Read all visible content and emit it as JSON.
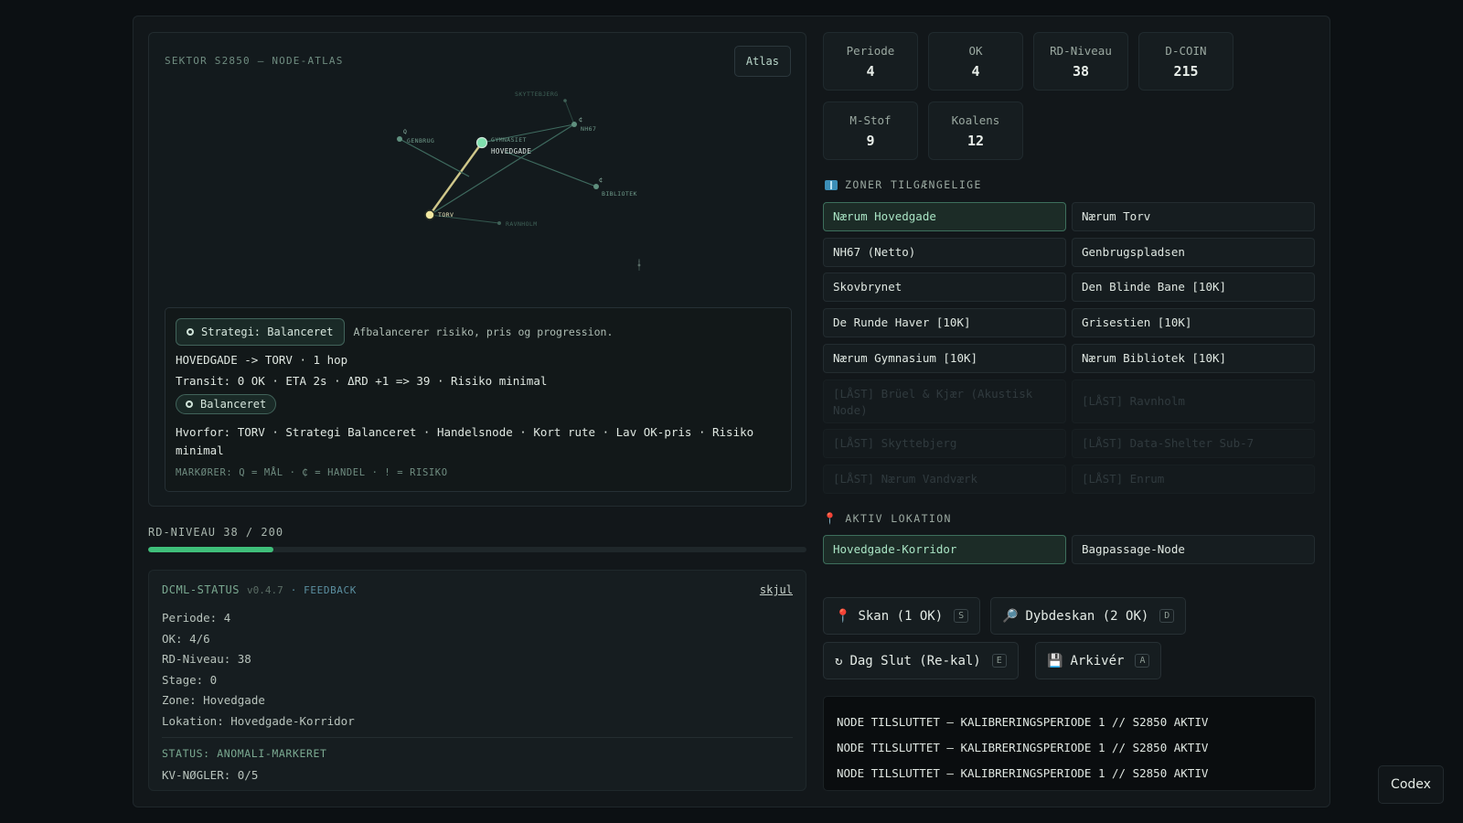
{
  "atlas": {
    "title": "SEKTOR S2850 — NODE-ATLAS",
    "button": "Atlas",
    "nodes": [
      {
        "id": "genbrug",
        "label": "GENBRUG",
        "marker": "Q"
      },
      {
        "id": "gymnasiet",
        "label": "GYMNASIET",
        "marker": ""
      },
      {
        "id": "hovedgade",
        "label": "HOVEDGADE",
        "marker": ""
      },
      {
        "id": "nh67",
        "label": "NH67",
        "marker": "₵"
      },
      {
        "id": "bibliotek",
        "label": "BIBLIOTEK",
        "marker": "₵"
      },
      {
        "id": "torv",
        "label": "TORV",
        "marker": ""
      },
      {
        "id": "ravnholm",
        "label": "RAVNHOLM",
        "marker": ""
      },
      {
        "id": "skyttebjerg",
        "label": "SKYTTEBJERG",
        "marker": ""
      }
    ],
    "dim_marker": "!"
  },
  "strategy": {
    "chip": "Strategi: Balanceret",
    "description": "Afbalancerer risiko, pris og progression.",
    "route": "HOVEDGADE -> TORV · 1 hop",
    "transit": "Transit: 0 OK · ETA 2s · ΔRD +1 => 39 · Risiko minimal",
    "pill": "Balanceret",
    "why": "Hvorfor: TORV · Strategi Balanceret · Handelsnode · Kort rute · Lav OK-pris · Risiko minimal",
    "markers": "MARKØRER: Q = MÅL · ₵ = HANDEL · ! = RISIKO"
  },
  "rd": {
    "label": "RD-NIVEAU 38 / 200",
    "current": 38,
    "max": 200,
    "color": "#3fbf7a"
  },
  "status": {
    "title": "DCML-STATUS",
    "version": "v0.4.7",
    "feedback": "· FEEDBACK",
    "hide": "skjul",
    "lines": [
      "Periode: 4",
      "OK: 4/6",
      "RD-Niveau: 38",
      "Stage: 0",
      "Zone: Hovedgade",
      "Lokation: Hovedgade-Korridor"
    ],
    "anomaly": "STATUS: ANOMALI-MARKERET",
    "kv": "KV-NØGLER: 0/5"
  },
  "stats": [
    {
      "label": "Periode",
      "value": "4"
    },
    {
      "label": "OK",
      "value": "4"
    },
    {
      "label": "RD-Niveau",
      "value": "38"
    },
    {
      "label": "D-COIN",
      "value": "215"
    },
    {
      "label": "M-Stof",
      "value": "9"
    },
    {
      "label": "Koalens",
      "value": "12"
    }
  ],
  "zones": {
    "title": "ZONER TILGÆNGELIGE",
    "items": [
      {
        "label": "Nærum Hovedgade",
        "state": "active"
      },
      {
        "label": "Nærum Torv",
        "state": "open"
      },
      {
        "label": "NH67 (Netto)",
        "state": "open"
      },
      {
        "label": "Genbrugspladsen",
        "state": "open"
      },
      {
        "label": "Skovbrynet",
        "state": "open"
      },
      {
        "label": "Den Blinde Bane [10K]",
        "state": "open"
      },
      {
        "label": "De Runde Haver [10K]",
        "state": "open"
      },
      {
        "label": "Grisestien [10K]",
        "state": "open"
      },
      {
        "label": "Nærum Gymnasium [10K]",
        "state": "open"
      },
      {
        "label": "Nærum Bibliotek [10K]",
        "state": "open"
      },
      {
        "label": "[LÅST] Brüel & Kjær (Akustisk Node)",
        "state": "locked"
      },
      {
        "label": "[LÅST] Ravnholm",
        "state": "locked"
      },
      {
        "label": "[LÅST] Skyttebjerg",
        "state": "locked"
      },
      {
        "label": "[LÅST] Data-Shelter Sub-7",
        "state": "locked"
      },
      {
        "label": "[LÅST] Nærum Vandværk",
        "state": "locked"
      },
      {
        "label": "[LÅST] Enrum",
        "state": "locked"
      }
    ]
  },
  "location": {
    "title": "AKTIV LOKATION",
    "items": [
      {
        "label": "Hovedgade-Korridor",
        "state": "active"
      },
      {
        "label": "Bagpassage-Node",
        "state": "open"
      }
    ]
  },
  "actions": [
    {
      "icon": "pin-icon",
      "label": "Skan (1 OK)",
      "key": "S"
    },
    {
      "icon": "magnifier-icon",
      "label": "Dybdeskan (2 OK)",
      "key": "D"
    },
    {
      "icon": "refresh-icon",
      "label": "Dag Slut (Re-kal)",
      "key": "E"
    },
    {
      "icon": "floppy-icon",
      "label": "Arkivér",
      "key": "A"
    }
  ],
  "log": [
    "NODE TILSLUTTET — KALIBRERINGSPERIODE 1 // S2850 AKTIV",
    "NODE TILSLUTTET — KALIBRERINGSPERIODE 1 // S2850 AKTIV",
    "NODE TILSLUTTET — KALIBRERINGSPERIODE 1 // S2850 AKTIV"
  ],
  "codex": "Codex"
}
